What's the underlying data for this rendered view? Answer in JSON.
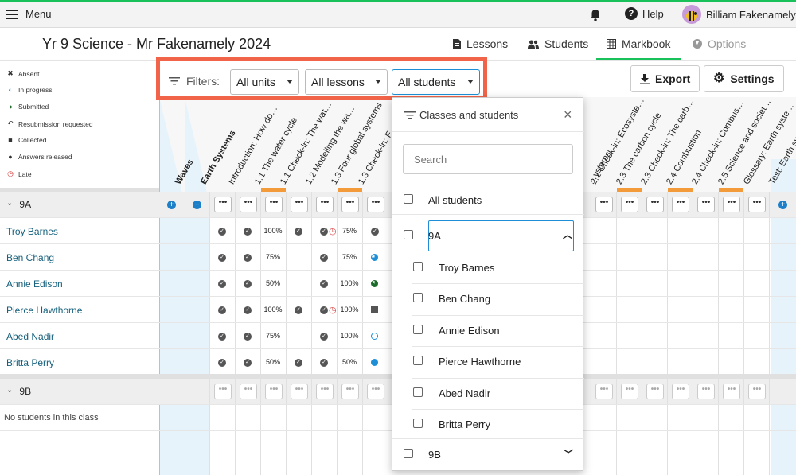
{
  "topbar": {
    "menu_label": "Menu",
    "help_label": "Help",
    "user_name": "Billiam Fakenamely"
  },
  "header": {
    "title": "Yr 9 Science - Mr Fakenamely 2024",
    "tabs": [
      {
        "label": "Lessons",
        "icon": "document-icon"
      },
      {
        "label": "Students",
        "icon": "people-icon"
      },
      {
        "label": "Markbook",
        "icon": "grid-icon",
        "active": true
      },
      {
        "label": "Options",
        "icon": "chevron-circle-icon",
        "disabled": true
      }
    ]
  },
  "legend": [
    {
      "label": "Absent",
      "icon": "absent-icon"
    },
    {
      "label": "In progress",
      "icon": "in-progress-icon"
    },
    {
      "label": "Submitted",
      "icon": "submitted-icon"
    },
    {
      "label": "Resubmission requested",
      "icon": "resubmission-icon"
    },
    {
      "label": "Collected",
      "icon": "lock-icon"
    },
    {
      "label": "Answers released",
      "icon": "check-circle-icon"
    },
    {
      "label": "Late",
      "icon": "late-clock-icon"
    }
  ],
  "filters": {
    "label": "Filters:",
    "units": "All units",
    "lessons": "All lessons",
    "students": "All students"
  },
  "toolbar": {
    "export_label": "Export",
    "settings_label": "Settings"
  },
  "columns": {
    "waves": "Waves",
    "earth": "Earth Systems",
    "left": [
      "Introduction: How do…",
      "1.1 The water cycle",
      "1.1 Check-in: The wat…",
      "1.2 Modelling the wa…",
      "1.3 Four global systems",
      "1.3 Check-in: F…"
    ],
    "right": [
      "…ystems",
      "2.2 Check-in: Ecosyste…",
      "2.3 The carbon cycle",
      "2.3 Check-in: The carb…",
      "2.4 Combustion",
      "2.4 Check-in: Combus…",
      "2.5 Science and societ…",
      "Glossary: Earth syste…",
      "Test: Earth syst…"
    ]
  },
  "classes": [
    {
      "name": "9A",
      "students": [
        {
          "name": "Troy Barnes",
          "marks": [
            "✔",
            "✔",
            "100%",
            "✔",
            "✔⏲",
            "75%",
            "✔"
          ]
        },
        {
          "name": "Ben Chang",
          "marks": [
            "✔",
            "✔",
            "75%",
            "",
            "✔",
            "75%",
            "in-progress"
          ]
        },
        {
          "name": "Annie Edison",
          "marks": [
            "✔",
            "✔",
            "50%",
            "",
            "✔",
            "100%",
            "submitted"
          ]
        },
        {
          "name": "Pierce Hawthorne",
          "marks": [
            "✔",
            "✔",
            "100%",
            "✔",
            "✔⏲",
            "100%",
            "collected"
          ]
        },
        {
          "name": "Abed Nadir",
          "marks": [
            "✔",
            "✔",
            "75%",
            "",
            "✔",
            "100%",
            "in-progress-ring"
          ]
        },
        {
          "name": "Britta Perry",
          "marks": [
            "✔",
            "✔",
            "50%",
            "✔",
            "✔",
            "50%",
            "blue-dot"
          ]
        }
      ]
    },
    {
      "name": "9B",
      "students": [],
      "empty_text": "No students in this class"
    }
  ],
  "popup": {
    "title": "Classes and students",
    "search_placeholder": "Search",
    "all_label": "All students",
    "class_a": "9A",
    "students_a": [
      "Troy Barnes",
      "Ben Chang",
      "Annie Edison",
      "Pierce Hawthorne",
      "Abed Nadir",
      "Britta Perry"
    ],
    "class_b": "9B"
  },
  "colors": {
    "accent": "#19c15a",
    "highlight": "#f26449",
    "link": "#16617d",
    "focus": "#1e8fd6",
    "overdue_bar": "#f39a3a"
  }
}
